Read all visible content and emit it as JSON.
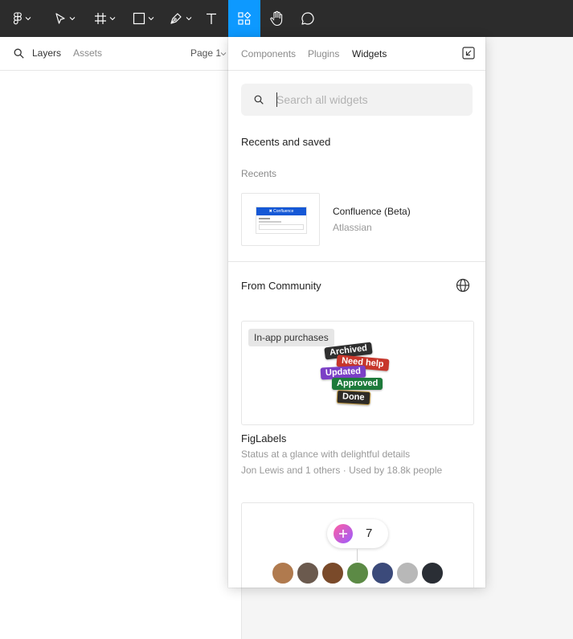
{
  "toolbar": {
    "tools": [
      {
        "name": "main-menu",
        "icon": "figma-logo-icon"
      },
      {
        "name": "move-tool",
        "icon": "cursor-icon"
      },
      {
        "name": "frame-tool",
        "icon": "frame-icon"
      },
      {
        "name": "shape-tool",
        "icon": "rectangle-icon"
      },
      {
        "name": "pen-tool",
        "icon": "pen-icon"
      },
      {
        "name": "text-tool",
        "icon": "text-icon"
      },
      {
        "name": "resources-tool",
        "icon": "resources-icon",
        "active": true
      },
      {
        "name": "hand-tool",
        "icon": "hand-icon"
      },
      {
        "name": "comment-tool",
        "icon": "comment-icon"
      }
    ],
    "active_color": "#0d99ff",
    "background": "#2c2c2c"
  },
  "left_panel": {
    "tabs": [
      "Layers",
      "Assets"
    ],
    "active_tab": "Layers",
    "page_selector": "Page 1"
  },
  "popup": {
    "tabs": [
      "Components",
      "Plugins",
      "Widgets"
    ],
    "active_tab": "Widgets",
    "search_placeholder": "Search all widgets",
    "recents_and_saved_title": "Recents and saved",
    "recents_label": "Recents",
    "recent_items": [
      {
        "name": "Confluence (Beta)",
        "author": "Atlassian",
        "thumb_header": "✖ Confluence"
      }
    ],
    "community_title": "From Community",
    "community_items": [
      {
        "badge": "In-app purchases",
        "name": "FigLabels",
        "description": "Status at a glance with delightful details",
        "meta": "Jon Lewis and 1 others · Used by 18.8k people",
        "labels": [
          {
            "text": "Archived",
            "color": "#2f2f2f"
          },
          {
            "text": "Need help",
            "color": "#c7362b"
          },
          {
            "text": "Updated",
            "color": "#7b3fc6"
          },
          {
            "text": "Approved",
            "color": "#1d7a3a"
          },
          {
            "text": "Done",
            "color": "#2d2a26"
          }
        ]
      },
      {
        "counter": "7"
      }
    ]
  }
}
